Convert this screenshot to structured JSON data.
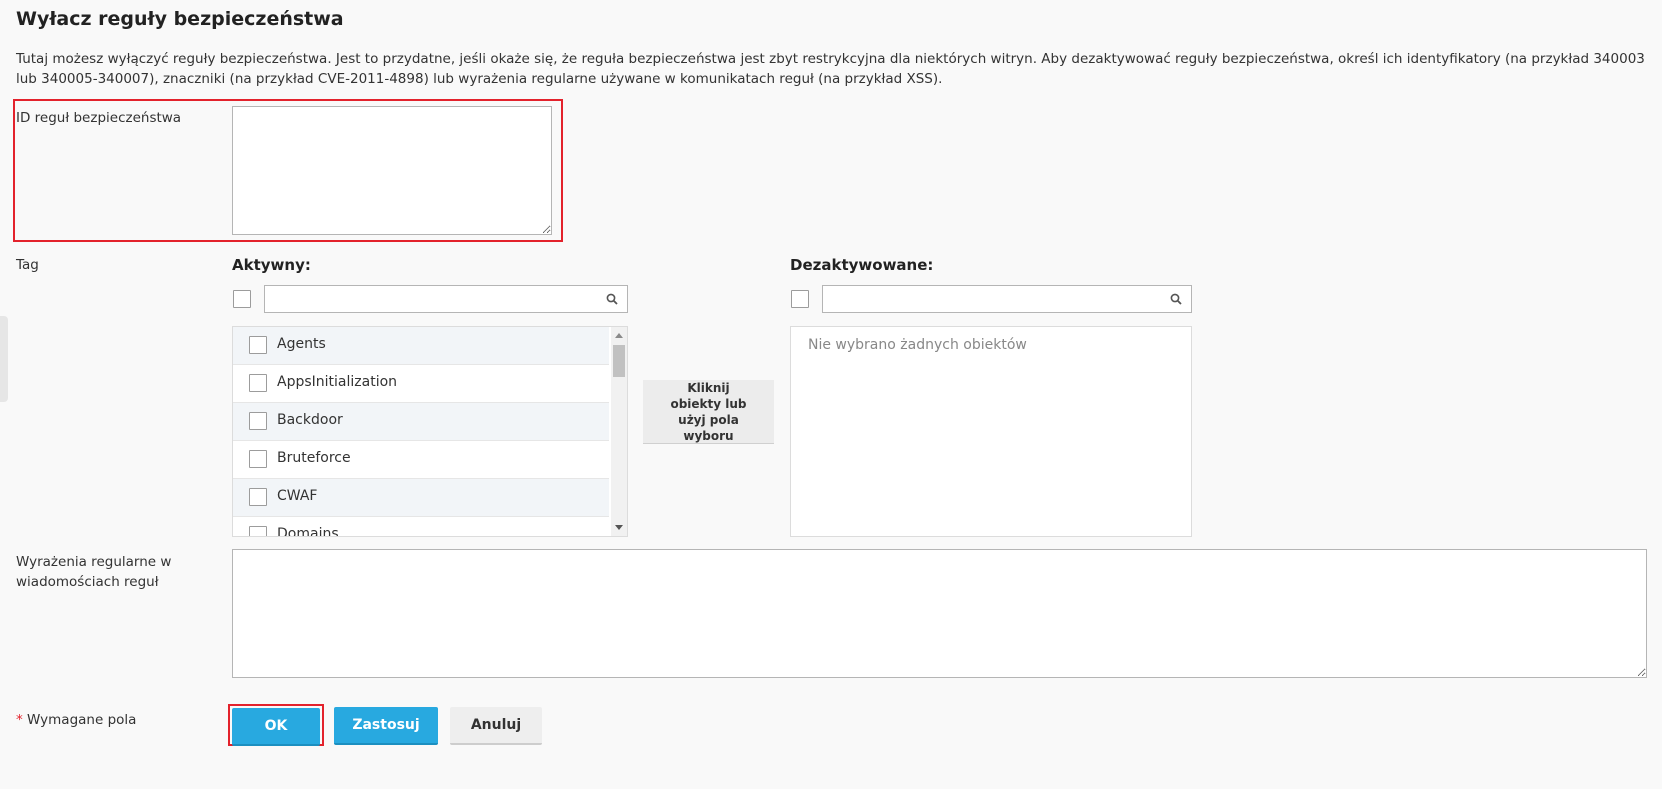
{
  "page": {
    "title": "Wyłacz reguły bezpieczeństwa",
    "description": "Tutaj możesz wyłączyć reguły bezpieczeństwa. Jest to przydatne, jeśli okaże się, że reguła bezpieczeństwa jest zbyt restrykcyjna dla niektórych witryn. Aby dezaktywować reguły bezpieczeństwa, określ ich identyfikatory (na przykład 340003 lub 340005-340007), znaczniki (na przykład CVE-2011-4898) lub wyrażenia regularne używane w komunikatach reguł (na przykład XSS)."
  },
  "form": {
    "rule_ids": {
      "label": "ID reguł bezpieczeństwa",
      "value": ""
    },
    "tags": {
      "label": "Tag",
      "active": {
        "heading": "Aktywny:",
        "search_value": "",
        "items": [
          "Agents",
          "AppsInitialization",
          "Backdoor",
          "Bruteforce",
          "CWAF",
          "Domains"
        ]
      },
      "move_button_label": "Kliknij obiekty lub użyj pola wyboru",
      "deactivated": {
        "heading": "Dezaktywowane:",
        "search_value": "",
        "empty_message": "Nie wybrano żadnych obiektów"
      }
    },
    "regex": {
      "label": "Wyrażenia regularne w wiadomościach reguł",
      "value": ""
    },
    "required_note": {
      "star": "*",
      "text": "Wymagane pola"
    }
  },
  "buttons": {
    "ok": "OK",
    "apply": "Zastosuj",
    "cancel": "Anuluj"
  },
  "colors": {
    "primary": "#28a9e0",
    "highlight": "#e3222c",
    "background": "#f9f9f9"
  },
  "icons": {
    "search": "search-icon",
    "side_tab": "panel-toggle"
  }
}
